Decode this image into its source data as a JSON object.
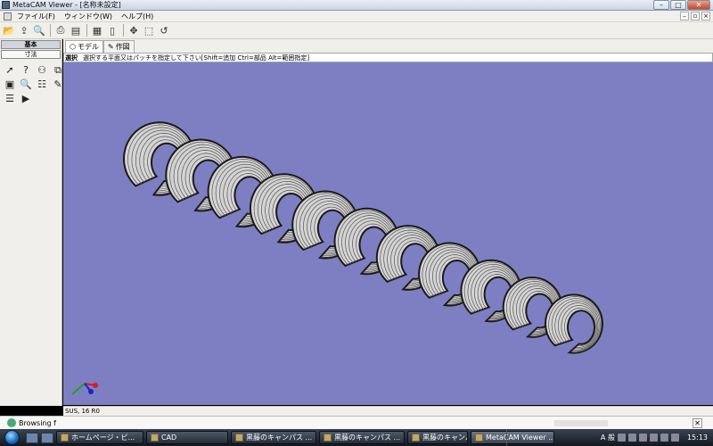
{
  "window": {
    "title": "MetaCAM Viewer - [名称未設定]"
  },
  "menu": {
    "items": [
      "ファイル(F)",
      "ウィンドウ(W)",
      "ヘルプ(H)"
    ]
  },
  "sidebar": {
    "tab_active": "基本",
    "tab_inactive": "寸法"
  },
  "view_tabs": [
    "モデル",
    "作図"
  ],
  "prompt": {
    "label": "選択",
    "text": "選択する平面又はパッチを指定して下さい[Shift=追加 Ctrl=部品 Alt=範囲指定]"
  },
  "status": {
    "text": "SUS, 16 R0"
  },
  "browsing": {
    "text": "Browsing f"
  },
  "taskbar": {
    "items": [
      "ホームページ・ビ...",
      "CAD",
      "黒藤のキャンパス ...",
      "黒藤のキャンパス ...",
      "黒藤のキャンパス ...",
      "MetaCAM Viewer ..."
    ],
    "tray_lang": "A 般",
    "clock": "15:13"
  },
  "colors": {
    "viewport": "#7e7fc2",
    "model_face": "#d4d4d4",
    "model_edge": "#1a1a1a"
  }
}
